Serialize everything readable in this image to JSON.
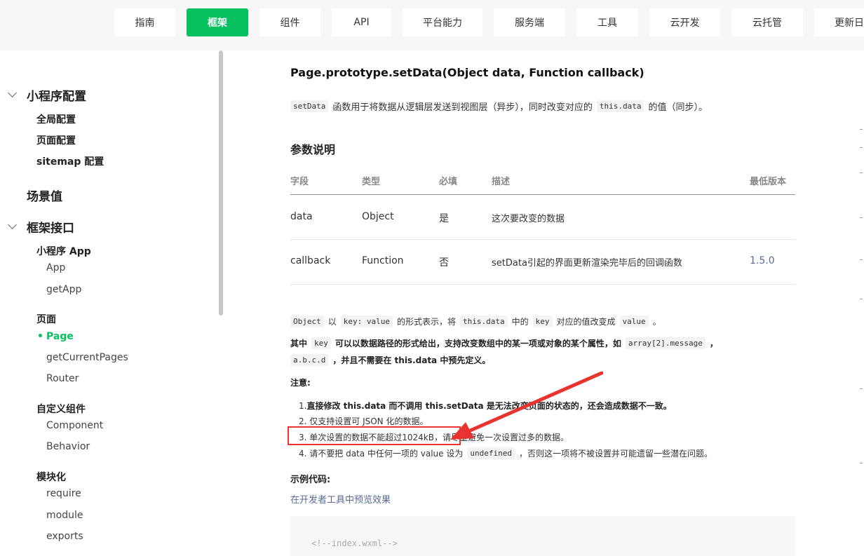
{
  "nav": {
    "items": [
      "指南",
      "框架",
      "组件",
      "API",
      "平台能力",
      "服务端",
      "工具",
      "云开发",
      "云托管",
      "更新日"
    ],
    "active_index": 1
  },
  "sidebar": {
    "miniprogram_config": "小程序配置",
    "global_config": "全局配置",
    "page_config": "页面配置",
    "sitemap_config": "sitemap 配置",
    "scene": "场景值",
    "framework_api": "框架接口",
    "app_group": "小程序 App",
    "app": "App",
    "getApp": "getApp",
    "page_group": "页面",
    "page_active": "Page",
    "getCurrentPages": "getCurrentPages",
    "router": "Router",
    "custom_group": "自定义组件",
    "component": "Component",
    "behavior": "Behavior",
    "module_group": "模块化",
    "require": "require",
    "module": "module",
    "exports": "exports"
  },
  "content": {
    "title": "Page.prototype.setData(Object data, Function callback)",
    "intro": {
      "code1": "setData",
      "text1": "函数用于将数据从逻辑层发送到视图层（异步），同时改变对应的",
      "code2": "this.data",
      "text2": "的值（同步）。"
    },
    "params_title": "参数说明",
    "table": {
      "headers": [
        "字段",
        "类型",
        "必填",
        "描述",
        "最低版本"
      ],
      "rows": [
        {
          "field": "data",
          "type": "Object",
          "required": "是",
          "desc": "这次要改变的数据",
          "version": ""
        },
        {
          "field": "callback",
          "type": "Function",
          "required": "否",
          "desc": "setData引起的界面更新渲染完毕后的回调函数",
          "version": "1.5.0"
        }
      ]
    },
    "object_line": {
      "c1": "Object",
      "t1": "以",
      "c2": "key: value",
      "t2": "的形式表示，将",
      "c3": "this.data",
      "t3": "中的",
      "c4": "key",
      "t4": "对应的值改变成",
      "c5": "value",
      "t5": "。"
    },
    "key_line": {
      "t1": "其中",
      "c1": "key",
      "t2": "可以以数据路径的形式给出，支持改变数组中的某一项或对象的某个属性，如",
      "c2": "array[2].message",
      "t3": "，",
      "c3": "a.b.c.d",
      "t4": "，并且不需要在 this.data 中预先定义。"
    },
    "note_title": "注意:",
    "notes": {
      "n1_pre": "1. ",
      "n1_bold": "直接修改 this.data 而不调用 this.setData 是无法改变页面的状态的，还会造成数据不一致。",
      "n2": "2. 仅支持设置可 JSON 化的数据。",
      "n3_a": "3. 单次设置的数据不能超过1024kB，",
      "n3_b": "请尽量避免一次设置过多的数据。",
      "n4_a": "4. 请不要把 data 中任何一项的 value 设为",
      "n4_code": "undefined",
      "n4_b": "，否则这一项将不被设置并可能遗留一些潜在问题。"
    },
    "example_title": "示例代码:",
    "preview_link": "在开发者工具中预览效果",
    "code_snippet": "<!--index.wxml-->"
  },
  "colors": {
    "accent": "#07c160",
    "link": "#576b95",
    "annotation": "#e8332e"
  }
}
